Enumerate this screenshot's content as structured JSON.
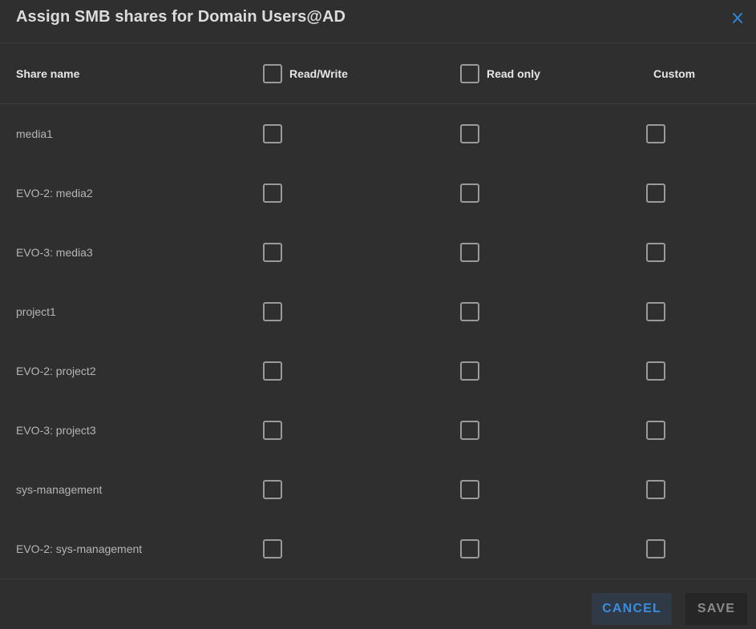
{
  "dialog": {
    "title": "Assign SMB shares for Domain Users@AD",
    "close_icon": "close-icon",
    "accent_color": "#2f86d6"
  },
  "columns": {
    "share_name": "Share name",
    "read_write": "Read/Write",
    "read_only": "Read only",
    "custom": "Custom"
  },
  "shares": [
    {
      "name": "media1",
      "read_write": false,
      "read_only": false,
      "custom": false
    },
    {
      "name": "EVO-2: media2",
      "read_write": false,
      "read_only": false,
      "custom": false
    },
    {
      "name": "EVO-3: media3",
      "read_write": false,
      "read_only": false,
      "custom": false
    },
    {
      "name": "project1",
      "read_write": false,
      "read_only": false,
      "custom": false
    },
    {
      "name": "EVO-2: project2",
      "read_write": false,
      "read_only": false,
      "custom": false
    },
    {
      "name": "EVO-3: project3",
      "read_write": false,
      "read_only": false,
      "custom": false
    },
    {
      "name": "sys-management",
      "read_write": false,
      "read_only": false,
      "custom": false
    },
    {
      "name": "EVO-2: sys-management",
      "read_write": false,
      "read_only": false,
      "custom": false
    }
  ],
  "footer": {
    "cancel_label": "CANCEL",
    "save_label": "SAVE"
  }
}
